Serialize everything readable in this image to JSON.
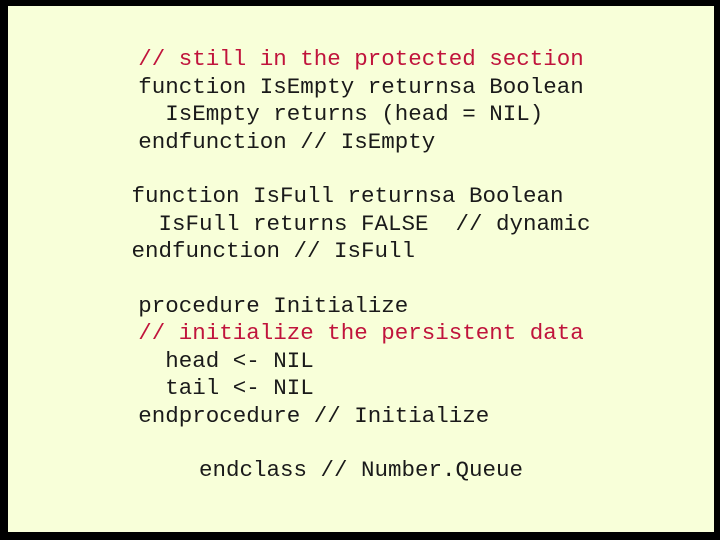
{
  "slide": {
    "background_color": "#F8FFD9",
    "frame_color": "#000000",
    "code_color": "#1A1A1A",
    "comment_color": "#C0143C",
    "blocks": [
      {
        "name": "is-empty-block",
        "lines": [
          {
            "text": "// still in the protected section",
            "kind": "comment"
          },
          {
            "text": "function IsEmpty returnsa Boolean",
            "kind": "code"
          },
          {
            "text": "  IsEmpty returns (head = NIL)",
            "kind": "code"
          },
          {
            "text": "endfunction // IsEmpty",
            "kind": "code"
          }
        ]
      },
      {
        "name": "is-full-block",
        "lines": [
          {
            "text": "function IsFull returnsa Boolean",
            "kind": "code"
          },
          {
            "text": "  IsFull returns FALSE  // dynamic",
            "kind": "code"
          },
          {
            "text": "endfunction // IsFull",
            "kind": "code"
          }
        ]
      },
      {
        "name": "initialize-block",
        "lines": [
          {
            "text": "procedure Initialize",
            "kind": "code"
          },
          {
            "text": "// initialize the persistent data",
            "kind": "comment"
          },
          {
            "text": "  head <- NIL",
            "kind": "code"
          },
          {
            "text": "  tail <- NIL",
            "kind": "code"
          },
          {
            "text": "endprocedure // Initialize",
            "kind": "code"
          }
        ]
      },
      {
        "name": "end-class-block",
        "lines": [
          {
            "text": "endclass // Number.Queue",
            "kind": "code"
          }
        ]
      }
    ]
  }
}
